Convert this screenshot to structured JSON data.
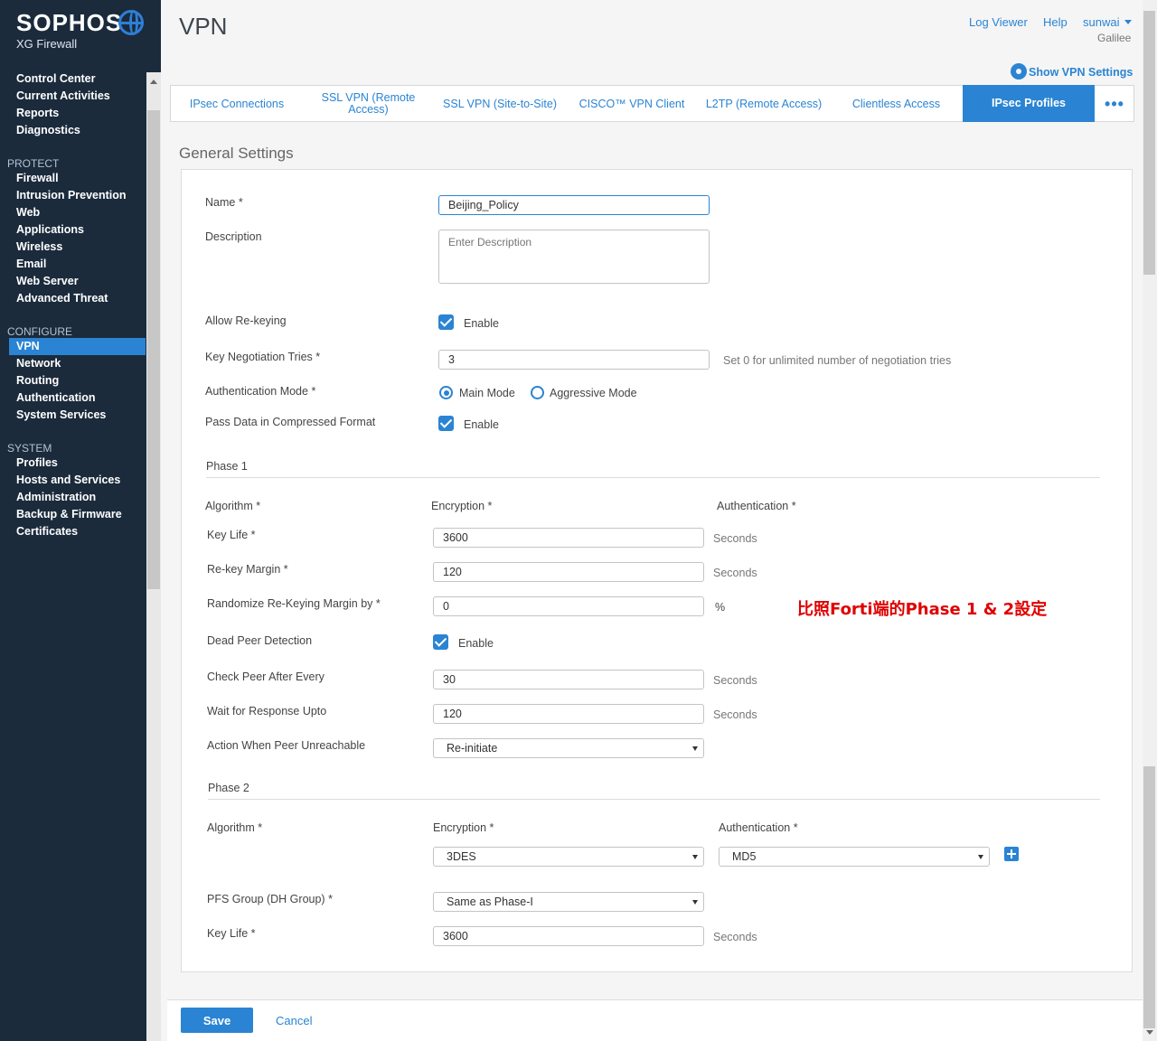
{
  "app": {
    "brand": "SOPHOS",
    "product": "XG Firewall"
  },
  "sidebar": {
    "top_items": [
      "Control Center",
      "Current Activities",
      "Reports",
      "Diagnostics"
    ],
    "protect_title": "PROTECT",
    "protect_items": [
      "Firewall",
      "Intrusion Prevention",
      "Web",
      "Applications",
      "Wireless",
      "Email",
      "Web Server",
      "Advanced Threat"
    ],
    "configure_title": "CONFIGURE",
    "configure_items": [
      "VPN",
      "Network",
      "Routing",
      "Authentication",
      "System Services"
    ],
    "system_title": "SYSTEM",
    "system_items": [
      "Profiles",
      "Hosts and Services",
      "Administration",
      "Backup & Firmware",
      "Certificates"
    ],
    "active_item": "VPN"
  },
  "header": {
    "title": "VPN",
    "log_viewer": "Log Viewer",
    "help": "Help",
    "user": "sunwai",
    "org": "Galilee",
    "vpn_settings": "Show VPN Settings"
  },
  "tabs": [
    {
      "label": "IPsec Connections"
    },
    {
      "label": "SSL VPN (Remote Access)"
    },
    {
      "label": "SSL VPN (Site-to-Site)"
    },
    {
      "label": "CISCO™ VPN Client"
    },
    {
      "label": "L2TP (Remote Access)"
    },
    {
      "label": "Clientless Access"
    },
    {
      "label": "IPsec Profiles",
      "active": true
    }
  ],
  "tab_more": "•••",
  "form": {
    "section_title": "General Settings",
    "name_label": "Name *",
    "name_value": "Beijing_Policy",
    "description_label": "Description",
    "description_placeholder": "Enter Description",
    "allow_rekey_label": "Allow Re-keying",
    "allow_rekey_checked": true,
    "enable_label": "Enable",
    "key_neg_label": "Key Negotiation Tries *",
    "key_neg_value": "3",
    "key_neg_hint": "Set 0 for unlimited number of negotiation tries",
    "auth_mode_label": "Authentication Mode *",
    "auth_mode_main": "Main Mode",
    "auth_mode_aggressive": "Aggressive Mode",
    "auth_mode_selected": "Main Mode",
    "compress_label": "Pass Data in Compressed Format",
    "compress_checked": true,
    "phase1": {
      "title": "Phase 1",
      "algorithm_label": "Algorithm *",
      "encryption_label": "Encryption *",
      "authentication_label": "Authentication *",
      "key_life_label": "Key Life *",
      "key_life_value": "3600",
      "rekey_margin_label": "Re-key Margin *",
      "rekey_margin_value": "120",
      "randomize_label": "Randomize Re-Keying Margin by *",
      "randomize_value": "0",
      "percent": "%",
      "dpd_label": "Dead Peer Detection",
      "dpd_checked": true,
      "check_peer_label": "Check Peer After Every",
      "check_peer_value": "30",
      "wait_label": "Wait for Response Upto",
      "wait_value": "120",
      "action_label": "Action When Peer Unreachable",
      "action_value": "Re-initiate"
    },
    "seconds": "Seconds",
    "phase2": {
      "title": "Phase 2",
      "algorithm_label": "Algorithm *",
      "encryption_label": "Encryption *",
      "authentication_label": "Authentication *",
      "encryption_value": "3DES",
      "authentication_value": "MD5",
      "pfs_label": "PFS Group (DH Group) *",
      "pfs_value": "Same as Phase-I",
      "key_life_label": "Key Life *",
      "key_life_value": "3600"
    }
  },
  "annotation": "比照Forti端的Phase 1 & 2設定",
  "footer": {
    "save": "Save",
    "cancel": "Cancel"
  },
  "colors": {
    "sidebar_bg": "#1b2b3c",
    "accent": "#2a84d3",
    "annotation": "#e00000"
  }
}
